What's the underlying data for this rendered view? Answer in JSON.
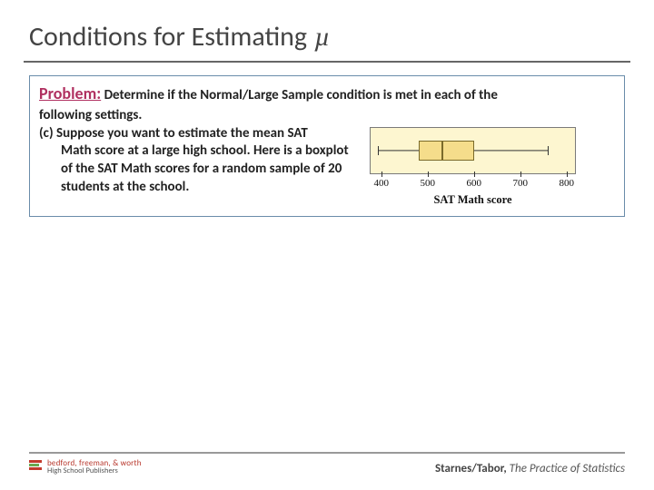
{
  "title": {
    "main": "Conditions for Estimating",
    "symbol": "µ"
  },
  "problem": {
    "lead": "Problem:",
    "intro_rest": " Determine if the Normal/Large Sample condition is met in each of the",
    "line2": "following settings.",
    "part_label": "(c) ",
    "part_body": "Suppose you want to estimate the mean SAT Math score at a large high school. Here is a boxplot of the SAT Math scores for a random sample of 20 students at the school."
  },
  "chart_data": {
    "type": "boxplot",
    "axis_label": "SAT Math score",
    "ticks": [
      400,
      500,
      600,
      700,
      800
    ],
    "xlim": [
      375,
      820
    ],
    "min": 390,
    "q1": 480,
    "median": 530,
    "q3": 600,
    "max": 760
  },
  "footer": {
    "publisher_line1": "bedford, freeman, & worth",
    "publisher_line2": "High School Publishers",
    "authors": "Starnes/Tabor,",
    "book": "The Practice of Statistics"
  }
}
